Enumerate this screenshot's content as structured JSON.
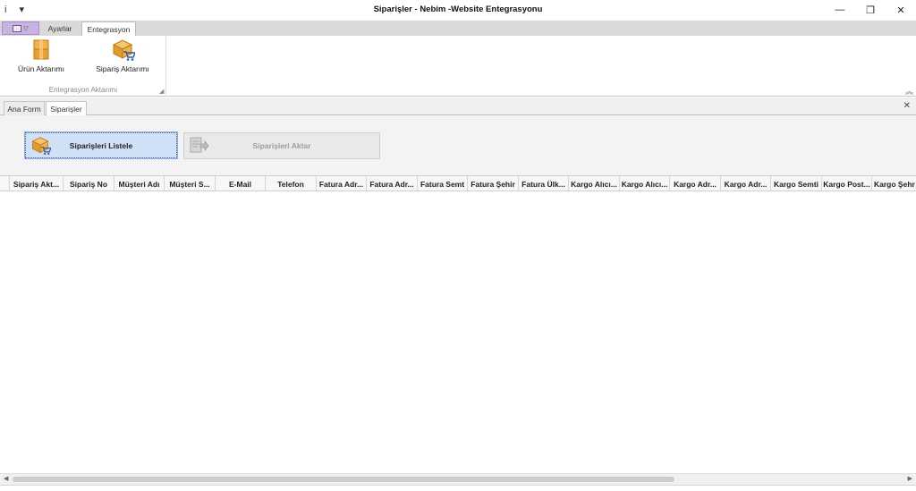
{
  "window": {
    "title": "Siparişler - Nebim -Website Entegrasyonu",
    "quick_access": [
      "i",
      "▾"
    ],
    "controls": {
      "minimize": "—",
      "restore": "❐",
      "close": "✕"
    }
  },
  "ribbon": {
    "tabs": [
      {
        "label": "Ayarlar"
      },
      {
        "label": "Entegrasyon"
      }
    ],
    "active_tab": "Entegrasyon",
    "group": {
      "label": "Entegrasyon Aktarımı",
      "buttons": [
        {
          "label": "Ürün Aktarımı",
          "icon": "box-stack-icon"
        },
        {
          "label": "Sipariş Aktarımı",
          "icon": "box-cart-icon"
        }
      ]
    }
  },
  "document_tabs": [
    {
      "label": "Ana Form"
    },
    {
      "label": "Siparişler"
    }
  ],
  "actions": {
    "list_button": "Siparişleri Listele",
    "transfer_button": "Siparişleri Aktar"
  },
  "grid": {
    "columns": [
      "Sipariş Akt...",
      "Sipariş No",
      "Müşteri Adı",
      "Müşteri S...",
      "E-Mail",
      "Telefon",
      "Fatura Adr...",
      "Fatura Adr...",
      "Fatura Semt",
      "Fatura Şehir",
      "Fatura Ülk...",
      "Kargo Alıcı...",
      "Kargo Alıcı...",
      "Kargo Adr...",
      "Kargo Adr...",
      "Kargo Semti",
      "Kargo Post...",
      "Kargo Şehr"
    ],
    "rows": []
  },
  "colors": {
    "accent_button": "#cfe0f7",
    "app_menu": "#c9b3e0"
  }
}
